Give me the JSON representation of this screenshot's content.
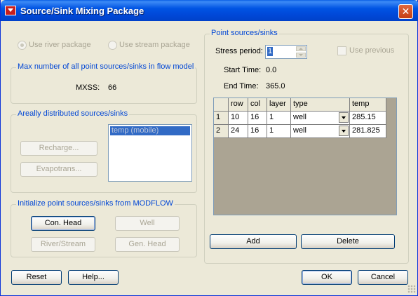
{
  "window": {
    "title": "Source/Sink Mixing Package",
    "close_label": "✕"
  },
  "package": {
    "river_label": "Use river package",
    "stream_label": "Use stream package"
  },
  "max_number": {
    "legend": "Max number of all point sources/sinks in flow model",
    "mxss_label": "MXSS:",
    "mxss_value": "66"
  },
  "areal": {
    "legend": "Areally distributed sources/sinks",
    "recharge_label": "Recharge...",
    "evapotrans_label": "Evapotrans...",
    "list_items": [
      "temp (mobile)"
    ]
  },
  "initialize": {
    "legend": "Initialize point sources/sinks from MODFLOW",
    "con_head_label": "Con. Head",
    "well_label": "Well",
    "river_stream_label": "River/Stream",
    "gen_head_label": "Gen. Head"
  },
  "point": {
    "legend": "Point sources/sinks",
    "stress_period_label": "Stress period:",
    "stress_period_value": "1",
    "use_previous_label": "Use previous",
    "start_time_label": "Start Time:",
    "start_time_value": "0.0",
    "end_time_label": "End Time:",
    "end_time_value": "365.0",
    "table": {
      "columns": [
        "row",
        "col",
        "layer",
        "type",
        "temp"
      ],
      "rows": [
        {
          "num": "1",
          "row": "10",
          "col": "16",
          "layer": "1",
          "type": "well",
          "temp": "285.15"
        },
        {
          "num": "2",
          "row": "24",
          "col": "16",
          "layer": "1",
          "type": "well",
          "temp": "281.825"
        }
      ]
    },
    "add_label": "Add",
    "delete_label": "Delete"
  },
  "footer": {
    "reset_label": "Reset",
    "help_label": "Help...",
    "ok_label": "OK",
    "cancel_label": "Cancel"
  }
}
